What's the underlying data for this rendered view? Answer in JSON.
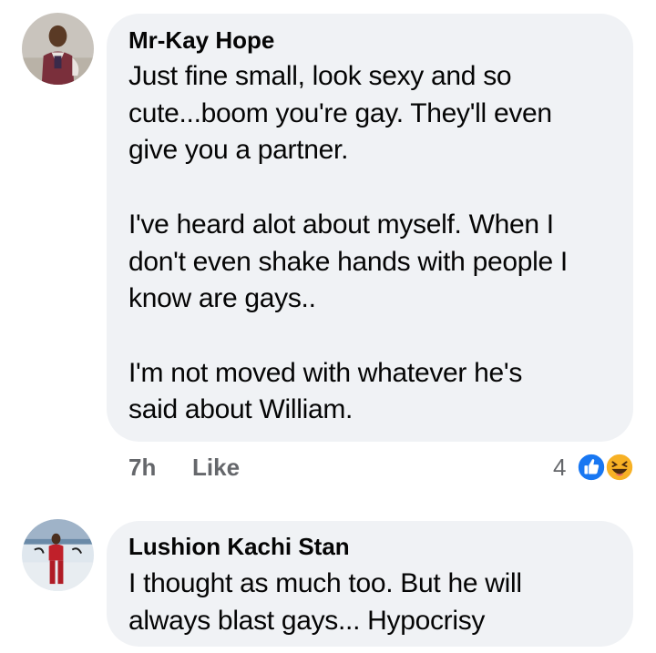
{
  "comments": [
    {
      "author": "Mr-Kay Hope",
      "text": "Just fine small, look sexy and so\ncute...boom you're gay. They'll even\ngive you a partner.\n\nI've heard alot about myself. When I\ndon't even shake hands with people I\nknow are gays..\n\nI'm not moved with whatever he's\nsaid about William.",
      "time": "7h",
      "like_label": "Like",
      "reaction_count": "4",
      "reactions": [
        "like-icon",
        "haha-icon"
      ],
      "colors": {
        "like": "#1877f2",
        "haha": "#f7b125"
      }
    },
    {
      "author": "Lushion Kachi Stan",
      "text": "I thought as much too. But he will\nalways blast gays... Hypocrisy"
    }
  ],
  "colors": {
    "bubble": "#f0f2f5",
    "meta_text": "#65676b",
    "body_text": "#050505"
  }
}
